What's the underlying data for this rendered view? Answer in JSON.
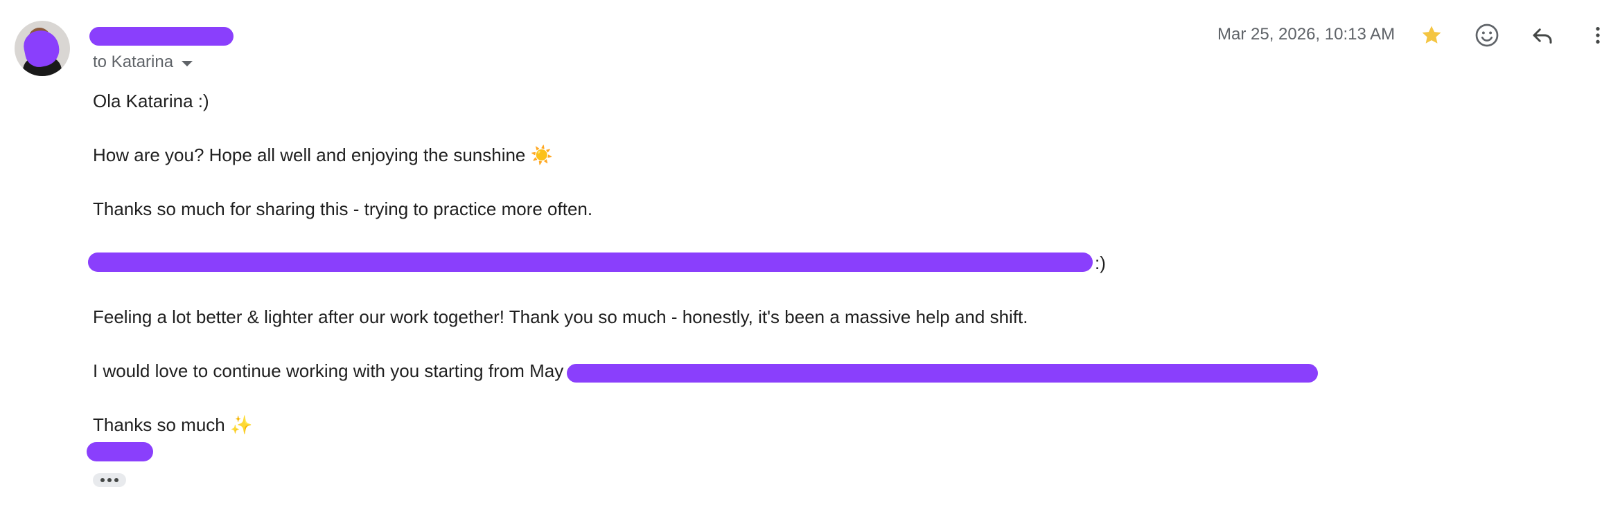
{
  "message": {
    "recipient_line": "to Katarina",
    "timestamp": "Mar 25, 2026, 10:13 AM",
    "starred": true,
    "body": {
      "line1": "Ola Katarina :)",
      "line2": "How are you? Hope all well and enjoying the sunshine ☀️",
      "line3": "Thanks so much for sharing this - trying to practice more often.",
      "line4_tail": ":)",
      "line5": "Feeling a lot better & lighter after our work together! Thank you so much - honestly, it's been a massive help and shift.",
      "line6_visible": "I would love to continue working with you starting from May",
      "line7": "Thanks so much ✨"
    }
  },
  "icons": {
    "star": "star-icon",
    "emoji": "add-reaction-icon",
    "reply": "reply-icon",
    "more": "more-vertical-icon",
    "expand": "show-trimmed-content-icon"
  },
  "colors": {
    "redaction": "#8a3ffc",
    "star": "#f4c542",
    "secondary_text": "#5f6368"
  }
}
